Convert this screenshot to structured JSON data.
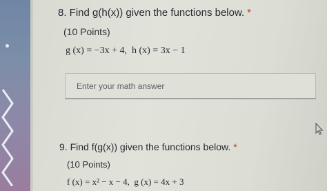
{
  "questions": [
    {
      "title": "8. Find g(h(x)) given the functions below.",
      "required_mark": "*",
      "points": "(10 Points)",
      "functions": {
        "part1": "g (x) = −3x + 4,",
        "part2": "h (x) = 3x − 1"
      },
      "answer_placeholder": "Enter your math answer"
    },
    {
      "title": "9. Find f(g(x)) given the functions below.",
      "required_mark": "*",
      "points": "(10 Points)",
      "functions": {
        "part1": "f (x) = x² − x − 4,",
        "part2": "g (x) = 4x + 3"
      }
    }
  ],
  "icons": {
    "cursor": "mouse-pointer-icon"
  }
}
